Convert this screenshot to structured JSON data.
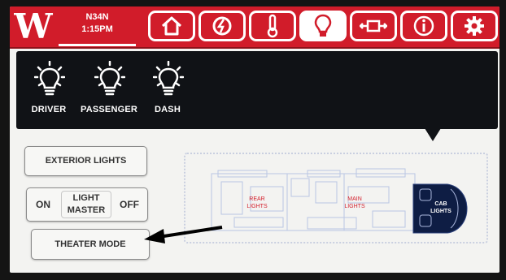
{
  "header": {
    "logo": "W",
    "location": "N34N",
    "time": "1:15PM"
  },
  "nav": [
    {
      "icon": "home-icon",
      "active": false
    },
    {
      "icon": "power-icon",
      "active": false
    },
    {
      "icon": "thermometer-icon",
      "active": false
    },
    {
      "icon": "lightbulb-icon",
      "active": true
    },
    {
      "icon": "slide-out-icon",
      "active": false
    },
    {
      "icon": "info-icon",
      "active": false
    },
    {
      "icon": "settings-gear-icon",
      "active": false
    }
  ],
  "lights": [
    {
      "label": "DRIVER",
      "icon": "lightbulb-icon"
    },
    {
      "label": "PASSENGER",
      "icon": "lightbulb-icon"
    },
    {
      "label": "DASH",
      "icon": "lightbulb-icon"
    }
  ],
  "controls": {
    "exterior_label": "EXTERIOR LIGHTS",
    "on_label": "ON",
    "master_line1": "LIGHT",
    "master_line2": "MASTER",
    "off_label": "OFF",
    "theater_label": "THEATER MODE"
  },
  "floorplan": {
    "rear_line1": "REAR",
    "rear_line2": "LIGHTS",
    "main_line1": "MAIN",
    "main_line2": "LIGHTS",
    "cab_line1": "CAB",
    "cab_line2": "LIGHTS"
  },
  "colors": {
    "brand_red": "#d11c2a",
    "panel_dark": "#101216",
    "zone_label_red": "#d31e2b",
    "cab_selected": "#0e1d44"
  }
}
